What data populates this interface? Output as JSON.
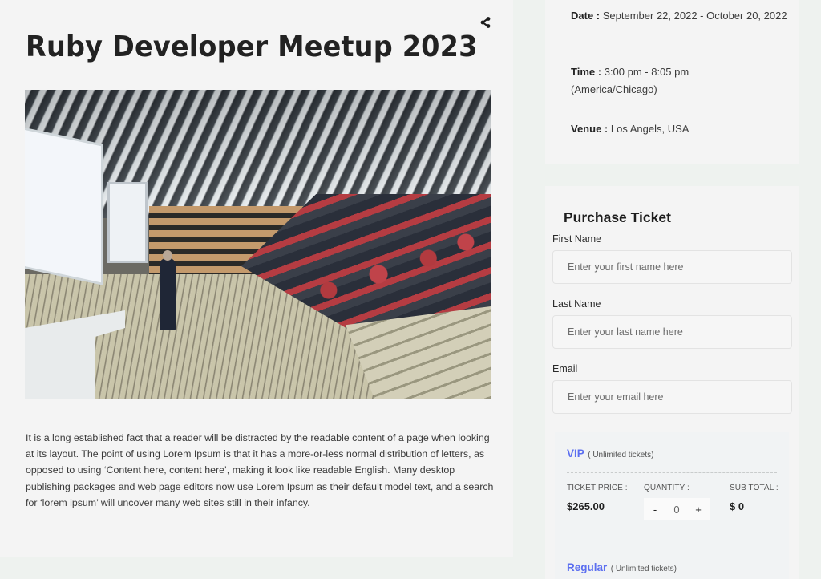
{
  "event": {
    "title": "Ruby Developer Meetup 2023",
    "share_icon": "share-icon",
    "image_alt": "Conference hall with speaker presenting to audience",
    "description": "It is a long established fact that a reader will be distracted by the readable content of a page when looking at its layout. The point of using Lorem Ipsum is that it has a more-or-less normal distribution of letters, as opposed to using ‘Content here, content here’, making it look like readable English. Many desktop publishing packages and web page editors now use Lorem Ipsum as their default model text, and a search for ‘lorem ipsum’ will uncover many web sites still in their infancy."
  },
  "info": {
    "date_label": "Date :",
    "date_value": "September 22, 2022 - October 20, 2022",
    "time_label": "Time :",
    "time_value": "3:00 pm - 8:05 pm (America/Chicago)",
    "venue_label": "Venue :",
    "venue_value": "Los Angels, USA"
  },
  "purchase": {
    "title": "Purchase Ticket",
    "fields": [
      {
        "label": "First Name",
        "placeholder": "Enter your first name here",
        "value": ""
      },
      {
        "label": "Last Name",
        "placeholder": "Enter your last name here",
        "value": ""
      },
      {
        "label": "Email",
        "placeholder": "Enter your email here",
        "value": ""
      }
    ],
    "tickets": [
      {
        "name": "VIP",
        "note": "( Unlimited tickets)",
        "price_label": "TICKET PRICE :",
        "price": "$265.00",
        "quantity_label": "QUANTITY :",
        "quantity": "0",
        "minus": "-",
        "plus": "+",
        "subtotal_label": "SUB TOTAL :",
        "subtotal": "$ 0"
      },
      {
        "name": "Regular",
        "note": "( Unlimited tickets)"
      }
    ],
    "accent_color": "#5c6ff0"
  }
}
